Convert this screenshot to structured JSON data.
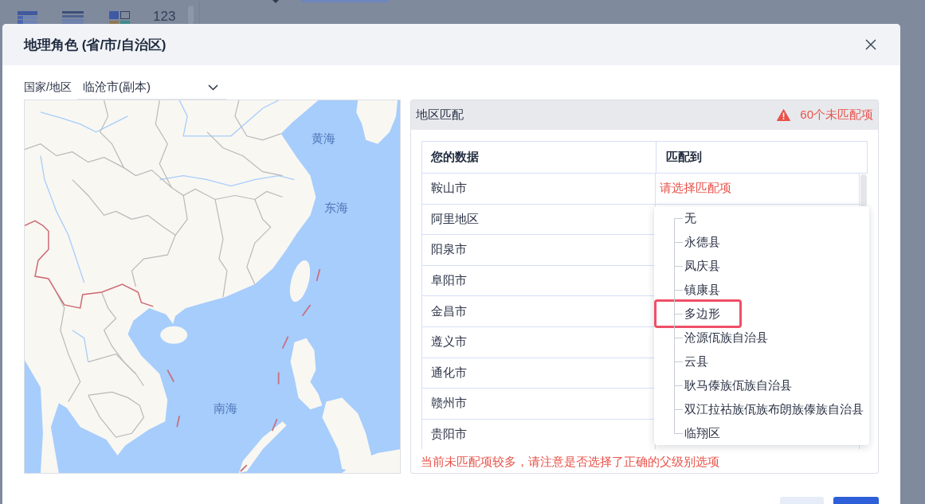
{
  "background": {
    "toolbar_label": "123"
  },
  "dialog": {
    "title": "地理角色 (省/市/自治区)"
  },
  "region_select": {
    "label": "国家/地区",
    "value": "临沧市(副本)"
  },
  "map": {
    "sea_labels": [
      "黄海",
      "东海",
      "南海"
    ]
  },
  "match_panel": {
    "title": "地区匹配",
    "unmatched_count": "60个未匹配项"
  },
  "table": {
    "columns": [
      "您的数据",
      "匹配到"
    ],
    "rows": [
      {
        "region": "鞍山市",
        "placeholder": "请选择匹配项"
      },
      {
        "region": "阿里地区"
      },
      {
        "region": "阳泉市"
      },
      {
        "region": "阜阳市"
      },
      {
        "region": "金昌市"
      },
      {
        "region": "遵义市"
      },
      {
        "region": "通化市"
      },
      {
        "region": "赣州市"
      },
      {
        "region": "贵阳市"
      }
    ]
  },
  "dropdown": {
    "items": [
      {
        "label": "无",
        "highlighted": false
      },
      {
        "label": "永德县",
        "highlighted": false
      },
      {
        "label": "凤庆县",
        "highlighted": false
      },
      {
        "label": "镇康县",
        "highlighted": false
      },
      {
        "label": "多边形",
        "highlighted": true
      },
      {
        "label": "沧源佤族自治县",
        "highlighted": false
      },
      {
        "label": "云县",
        "highlighted": false
      },
      {
        "label": "耿马傣族佤族自治县",
        "highlighted": false
      },
      {
        "label": "双江拉祜族佤族布朗族傣族自治县",
        "highlighted": false
      },
      {
        "label": "临翔区",
        "highlighted": false
      }
    ]
  },
  "warning": "当前未匹配项较多，请注意是否选择了正确的父级别选项",
  "footer": {
    "buttons": [
      {
        "kind": "secondary"
      },
      {
        "kind": "primary"
      }
    ]
  }
}
